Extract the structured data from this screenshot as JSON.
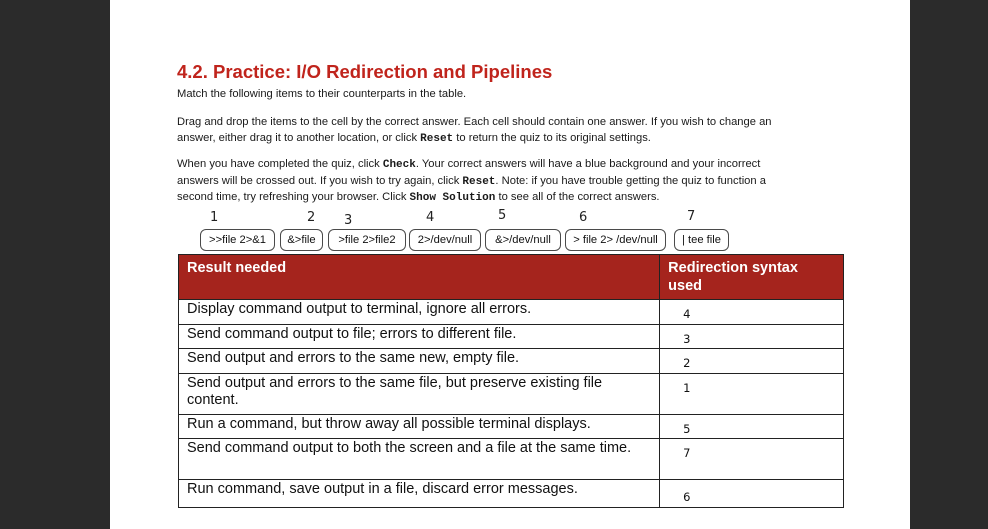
{
  "page": {
    "title": "4.2. Practice: I/O Redirection and Pipelines",
    "intro": "Match the following items to their counterparts in the table.",
    "drag_line1": "Drag and drop the items to the cell by the correct answer. Each cell should contain one answer. If you wish to change an",
    "drag_line2_a": "answer, either drag it to another location, or click ",
    "drag_line2_reset": "Reset",
    "drag_line2_b": " to return the quiz to its original settings.",
    "complete_line1_a": "When you have completed the quiz, click ",
    "complete_line1_check": "Check",
    "complete_line1_b": ". Your correct answers will have a blue background and your incorrect",
    "complete_line2_a": "answers will be crossed out. If you wish to try again, click ",
    "complete_line2_reset": "Reset",
    "complete_line2_b": ". Note: if you have trouble getting the quiz to function a",
    "complete_line3_a": "second time, try refreshing your browser. Click ",
    "complete_line3_show": "Show Solution",
    "complete_line3_b": " to see all of the correct answers."
  },
  "handwritten_numbers": [
    "1",
    "2",
    "3",
    "4",
    "5",
    "6",
    "7"
  ],
  "chips": [
    ">>file 2>&1",
    "&>file",
    ">file 2>file2",
    "2>/dev/null",
    "&>/dev/null",
    "> file 2> /dev/null",
    "| tee file"
  ],
  "table": {
    "header_result": "Result needed",
    "header_syntax": "Redirection syntax used",
    "rows": [
      {
        "result": "Display command output to terminal, ignore all errors.",
        "answer": "4"
      },
      {
        "result": "Send command output to file; errors to different file.",
        "answer": "3"
      },
      {
        "result": "Send output and errors to the same new, empty file.",
        "answer": "2"
      },
      {
        "result": "Send output and errors to the same file, but preserve existing file content.",
        "answer": "1"
      },
      {
        "result": "Run a command, but throw away all possible terminal displays.",
        "answer": "5"
      },
      {
        "result": "Send command output to both the screen and a file at the same time.",
        "answer": "7"
      },
      {
        "result": "Run command, save output in a file, discard error messages.",
        "answer": "6"
      }
    ]
  }
}
